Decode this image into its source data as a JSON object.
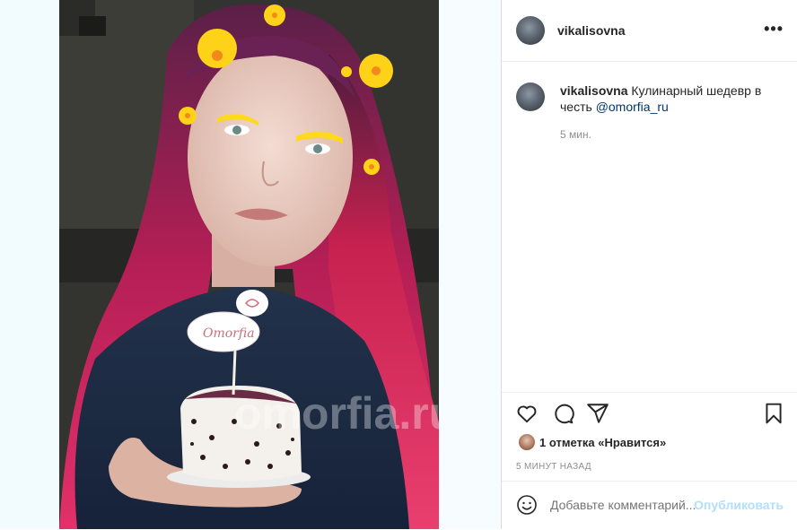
{
  "post": {
    "author": "vikalisovna",
    "more_icon": "more-horizontal-icon",
    "caption_user": "vikalisovna",
    "caption_text": "Кулинарный шедевр в честь",
    "caption_mention": "@omorfia_ru",
    "caption_time": "5 мин.",
    "likes_text": "1 отметка «Нравится»",
    "post_time": "5 МИНУТ НАЗАД"
  },
  "actions": {
    "like_icon": "heart-icon",
    "comment_icon": "comment-icon",
    "share_icon": "share-icon",
    "save_icon": "bookmark-icon"
  },
  "comment": {
    "emoji_icon": "emoji-icon",
    "placeholder": "Добавьте комментарий...",
    "publish_label": "Опубликовать"
  },
  "photo": {
    "cake_topper_text": "Omorfia",
    "watermark": "omorfia.ru"
  },
  "colors": {
    "accent_disabled": "#b2dffc",
    "mention": "#00376b",
    "hair": "#d8245a",
    "flower": "#ffd21a"
  }
}
